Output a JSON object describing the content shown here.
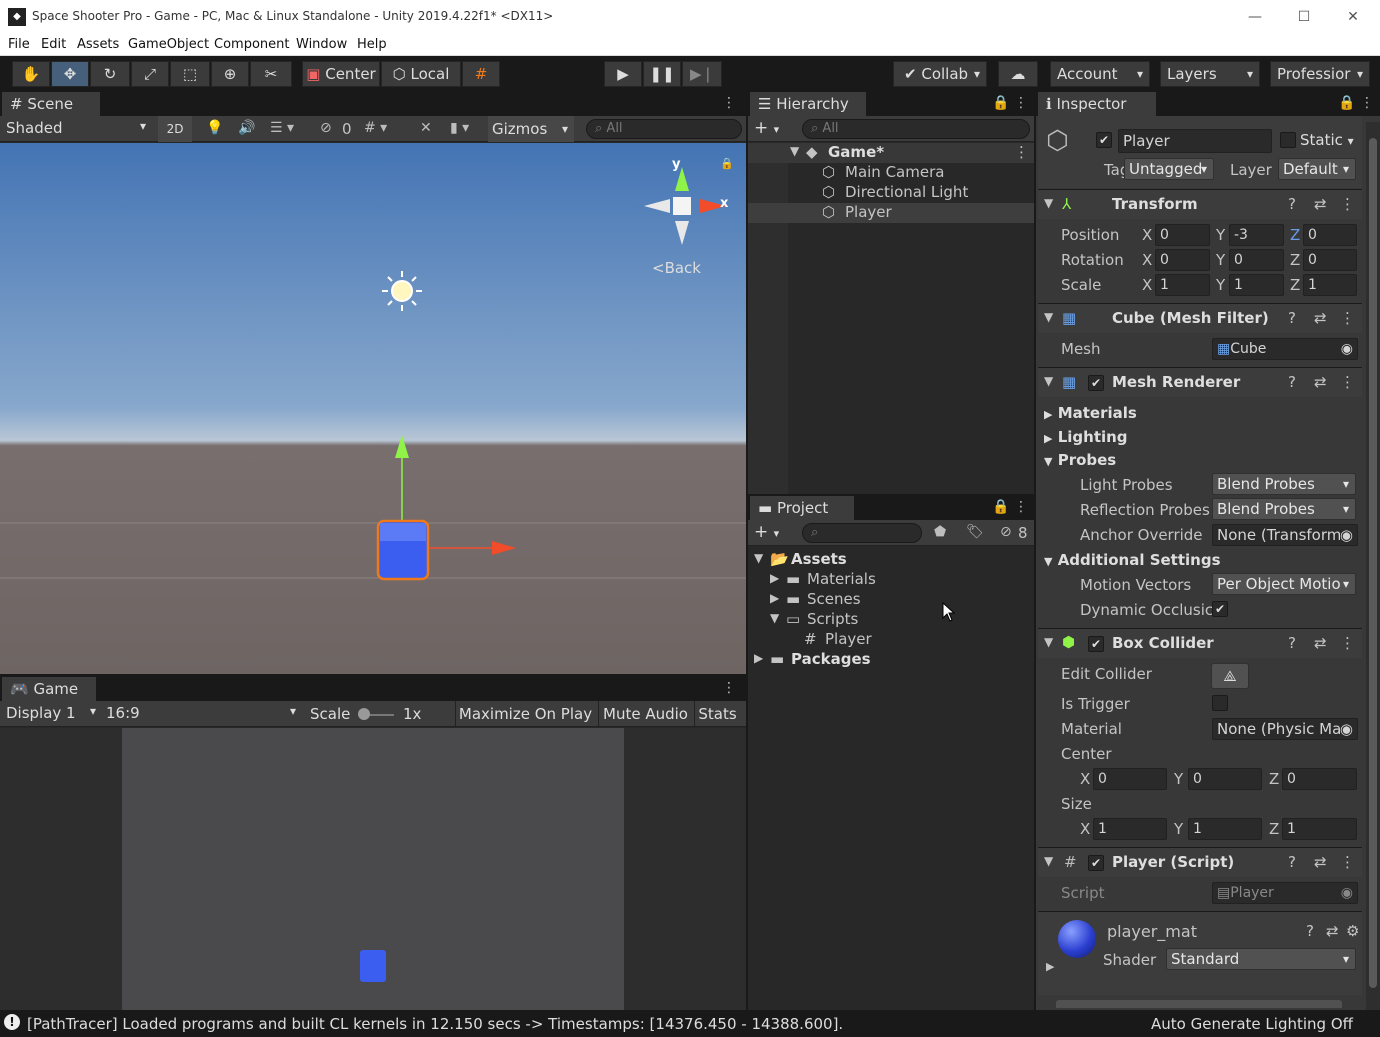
{
  "window": {
    "title": "Space Shooter Pro - Game - PC, Mac & Linux Standalone - Unity 2019.4.22f1* <DX11>",
    "minimize": "—",
    "maximize": "☐",
    "close": "✕"
  },
  "menu": [
    "File",
    "Edit",
    "Assets",
    "GameObject",
    "Component",
    "Window",
    "Help"
  ],
  "toolbar": {
    "center": "Center",
    "local": "Local",
    "collab": "Collab",
    "account": "Account",
    "layers": "Layers",
    "layout": "Professior"
  },
  "scene": {
    "tab": "Scene",
    "shading": "Shaded",
    "mode_2d": "2D",
    "hidden_count": "0",
    "gizmos": "Gizmos",
    "search_placeholder": "All",
    "gizmo_back": "Back",
    "axis_y": "y",
    "axis_x": "x"
  },
  "game": {
    "tab": "Game",
    "display": "Display 1",
    "aspect": "16:9",
    "scale_label": "Scale",
    "scale_value": "1x",
    "maximize": "Maximize On Play",
    "mute": "Mute Audio",
    "stats": "Stats"
  },
  "hierarchy": {
    "tab": "Hierarchy",
    "search_placeholder": "All",
    "scene_name": "Game*",
    "items": [
      "Main Camera",
      "Directional Light",
      "Player"
    ]
  },
  "project": {
    "tab": "Project",
    "hidden_count": "8",
    "assets": "Assets",
    "folders": [
      "Materials",
      "Scenes",
      "Scripts"
    ],
    "script_file": "Player",
    "packages": "Packages"
  },
  "inspector": {
    "tab": "Inspector",
    "object_name": "Player",
    "static_label": "Static",
    "tag_label": "Tag",
    "tag_value": "Untagged",
    "layer_label": "Layer",
    "layer_value": "Default",
    "transform": {
      "title": "Transform",
      "position_label": "Position",
      "rotation_label": "Rotation",
      "scale_label": "Scale",
      "position": [
        "0",
        "-3",
        "0"
      ],
      "rotation": [
        "0",
        "0",
        "0"
      ],
      "scale": [
        "1",
        "1",
        "1"
      ]
    },
    "axis": [
      "X",
      "Y",
      "Z"
    ],
    "mesh_filter": {
      "title": "Cube (Mesh Filter)",
      "mesh_label": "Mesh",
      "mesh_value": "Cube"
    },
    "mesh_renderer": {
      "title": "Mesh Renderer",
      "materials": "Materials",
      "lighting": "Lighting",
      "probes": "Probes",
      "light_probes_label": "Light Probes",
      "light_probes_value": "Blend Probes",
      "reflection_probes_label": "Reflection Probes",
      "reflection_probes_value": "Blend Probes",
      "anchor_label": "Anchor Override",
      "anchor_value": "None (Transform",
      "additional": "Additional Settings",
      "motion_label": "Motion Vectors",
      "motion_value": "Per Object Motio",
      "dynamic_label": "Dynamic Occlusic"
    },
    "box_collider": {
      "title": "Box Collider",
      "edit_label": "Edit Collider",
      "trigger_label": "Is Trigger",
      "material_label": "Material",
      "material_value": "None (Physic Ma",
      "center_label": "Center",
      "center": [
        "0",
        "0",
        "0"
      ],
      "size_label": "Size",
      "size": [
        "1",
        "1",
        "1"
      ]
    },
    "player_script": {
      "title": "Player (Script)",
      "script_label": "Script",
      "script_value": "Player"
    },
    "material": {
      "name": "player_mat",
      "shader_label": "Shader",
      "shader_value": "Standard"
    }
  },
  "status": {
    "message": "[PathTracer] Loaded programs and built CL kernels in 12.150 secs -> Timestamps: [14376.450 - 14388.600].",
    "lighting": "Auto Generate Lighting Off"
  },
  "colors": {
    "accent_blue": "#46607c",
    "selection": "#3e3e3e",
    "cube_blue": "#3b5df0",
    "selection_outline": "#f07a1a"
  }
}
